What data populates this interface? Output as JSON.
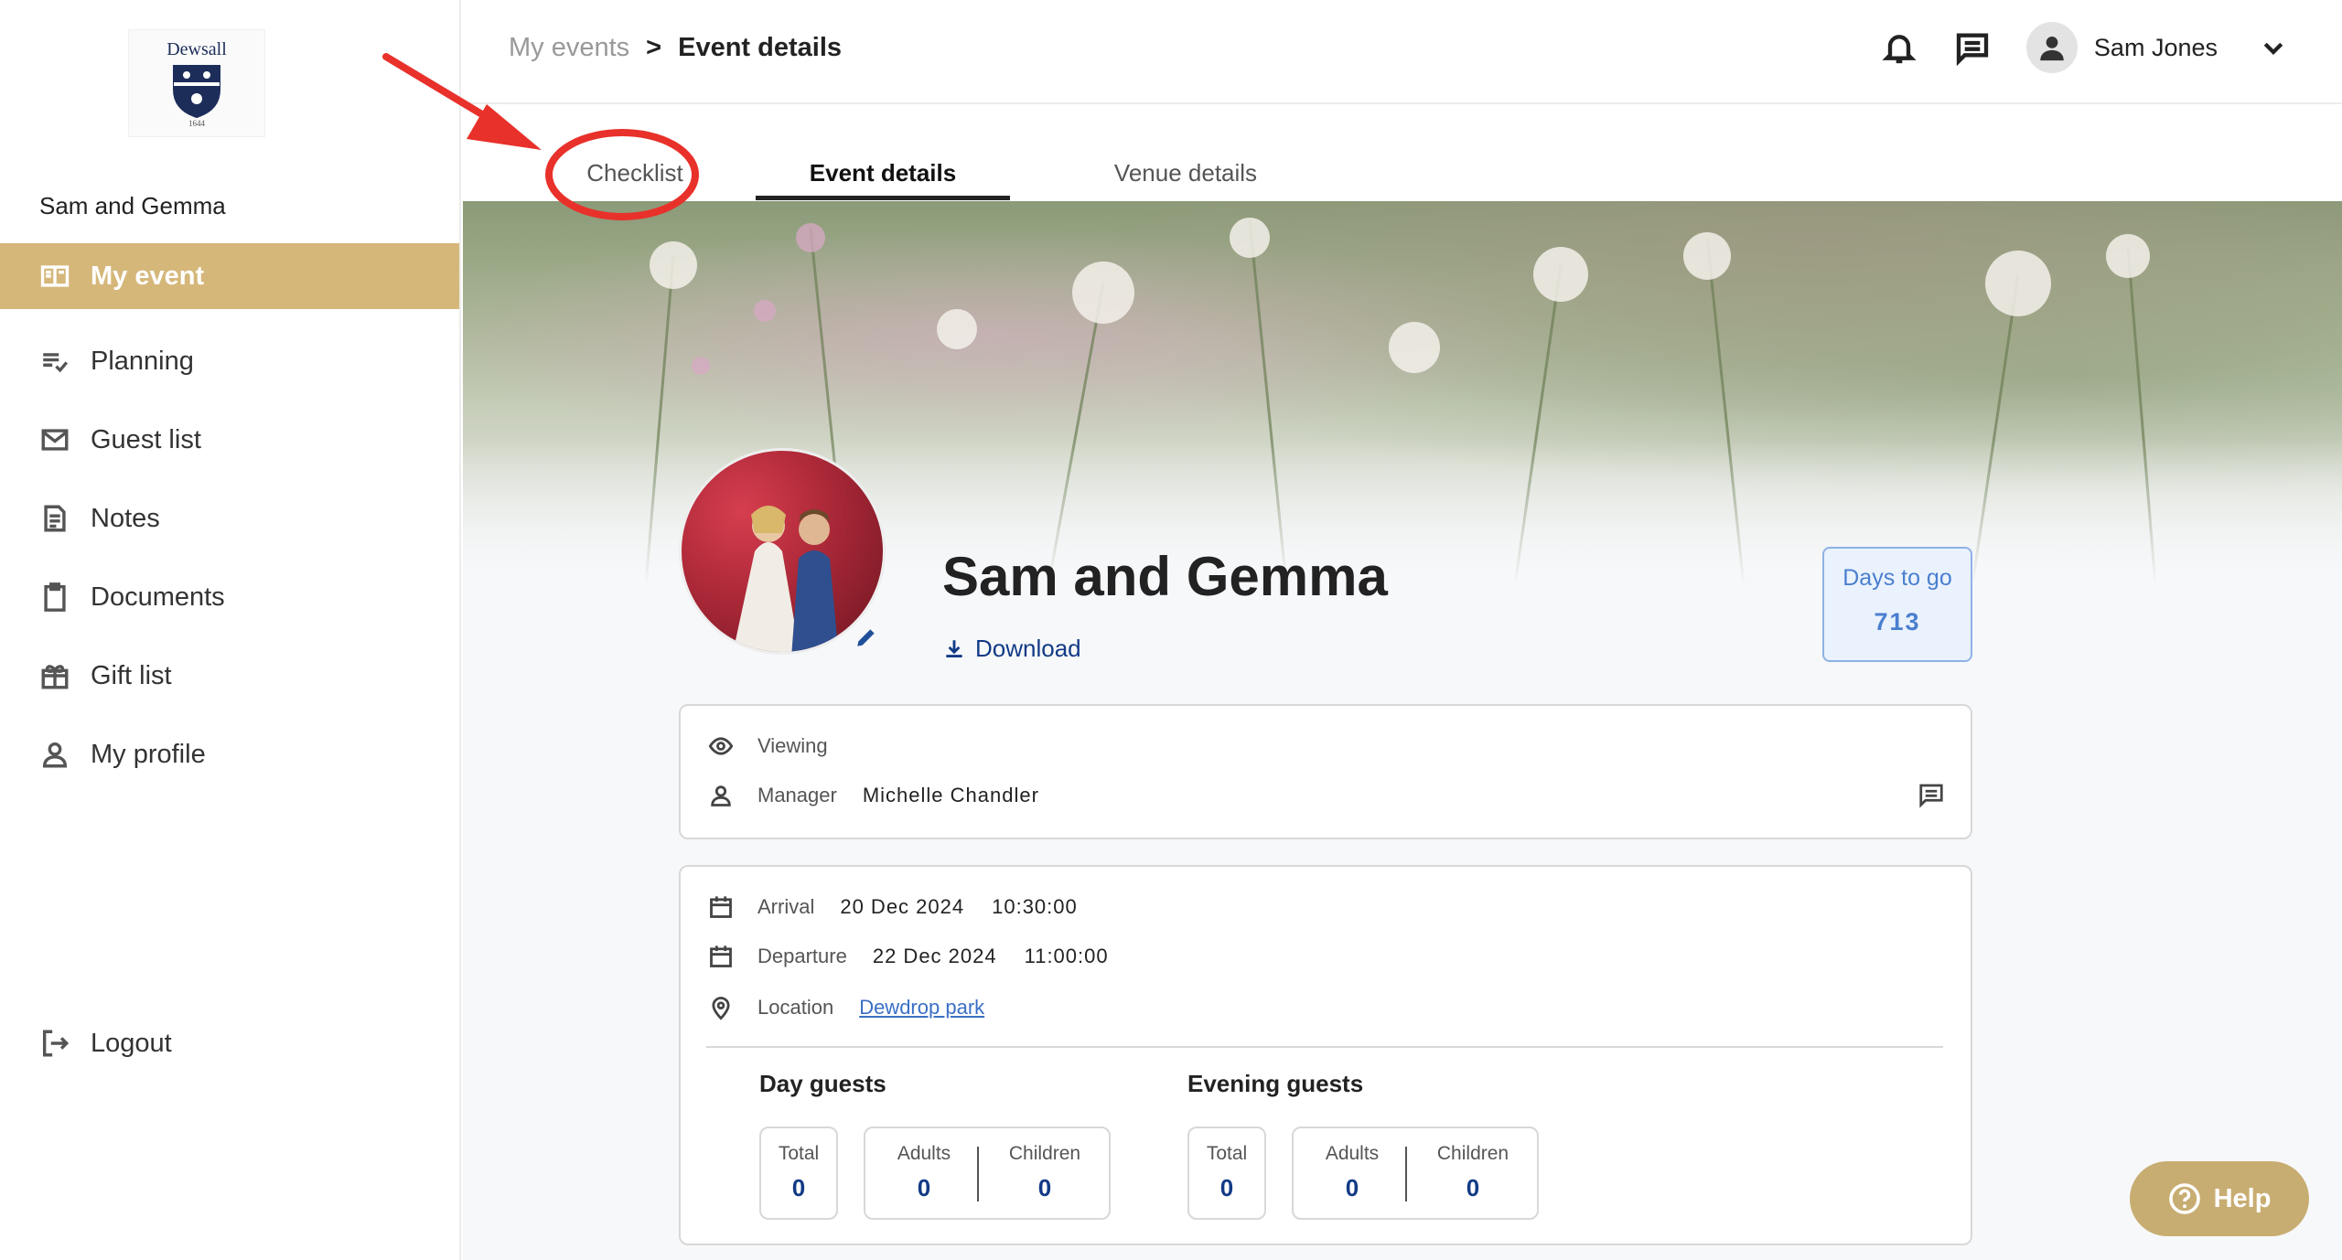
{
  "brand": {
    "logo_text": "Dewsall",
    "logo_year": "1644"
  },
  "sidebar": {
    "event_name": "Sam and Gemma",
    "items": [
      {
        "label": "My event",
        "icon": "book-open-icon",
        "active": true
      },
      {
        "label": "Planning",
        "icon": "checklist-icon",
        "active": false
      },
      {
        "label": "Guest list",
        "icon": "mail-icon",
        "active": false
      },
      {
        "label": "Notes",
        "icon": "note-icon",
        "active": false
      },
      {
        "label": "Documents",
        "icon": "clipboard-icon",
        "active": false
      },
      {
        "label": "Gift list",
        "icon": "gift-icon",
        "active": false
      },
      {
        "label": "My profile",
        "icon": "user-icon",
        "active": false
      }
    ],
    "logout_label": "Logout"
  },
  "header": {
    "breadcrumb_parent": "My events",
    "breadcrumb_separator": ">",
    "breadcrumb_current": "Event details",
    "user_name": "Sam Jones"
  },
  "tabs": [
    {
      "label": "Checklist"
    },
    {
      "label": "Event details",
      "active": true
    },
    {
      "label": "Venue details"
    }
  ],
  "event": {
    "title": "Sam and Gemma",
    "download_label": "Download",
    "days_to_go_label": "Days to go",
    "days_to_go_value": "713"
  },
  "contact": {
    "viewing_label": "Viewing",
    "manager_label": "Manager",
    "manager_name": "Michelle Chandler"
  },
  "details": {
    "arrival_label": "Arrival",
    "arrival_date": "20 Dec 2024",
    "arrival_time": "10:30:00",
    "departure_label": "Departure",
    "departure_date": "22 Dec 2024",
    "departure_time": "11:00:00",
    "location_label": "Location",
    "location_value": "Dewdrop park"
  },
  "guests": {
    "day": {
      "heading": "Day guests",
      "total_label": "Total",
      "total": "0",
      "adults_label": "Adults",
      "adults": "0",
      "children_label": "Children",
      "children": "0"
    },
    "evening": {
      "heading": "Evening guests",
      "total_label": "Total",
      "total": "0",
      "adults_label": "Adults",
      "adults": "0",
      "children_label": "Children",
      "children": "0"
    }
  },
  "help_label": "Help",
  "colors": {
    "accent_gold": "#d5b77a",
    "link_blue": "#123a86",
    "annotation_red": "#e8312a"
  }
}
